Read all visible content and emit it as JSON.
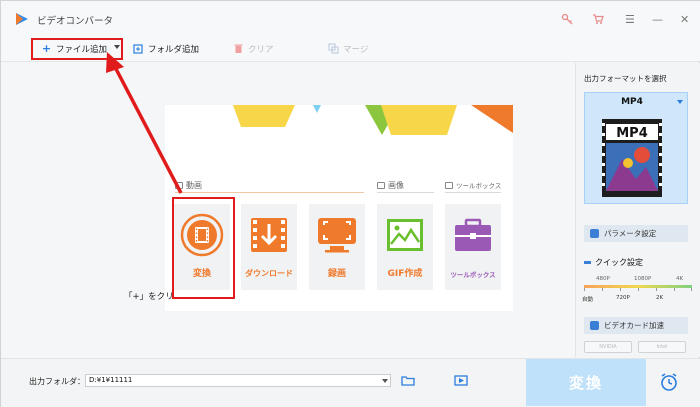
{
  "app": {
    "title": "ビデオコンバータ"
  },
  "window_controls": {
    "minimize": "—",
    "close": "✕",
    "menu": "☰"
  },
  "toolbar": {
    "add_file_label": "ファイル追加",
    "add_folder_label": "フォルダ追加",
    "clear_label": "クリア",
    "merge_label": "マージ"
  },
  "main": {
    "hint_text": "「+」をクリ",
    "sections": {
      "video": "動画",
      "image": "画像",
      "toolbox": "ツールボックス"
    },
    "cards": [
      {
        "label": "変換",
        "color": "#f07a2c"
      },
      {
        "label": "ダウンロード",
        "color": "#f07a2c"
      },
      {
        "label": "録画",
        "color": "#f07a2c"
      },
      {
        "label": "GIF作成",
        "color": "#f07a2c"
      },
      {
        "label": "ツールボックス",
        "color": "#9b59b6"
      }
    ]
  },
  "side": {
    "title": "出力フォーマットを選択",
    "format": "MP4",
    "format_badge": "MP4",
    "param_button": "パラメータ設定",
    "quick_title": "クイック設定",
    "scale_top": [
      "480P",
      "1080P",
      "4K"
    ],
    "scale_bottom": [
      "自動",
      "720P",
      "2K"
    ],
    "gpu_button": "ビデオカード加速",
    "hw": [
      "NVIDIA",
      "Intel"
    ]
  },
  "bottom": {
    "output_label": "出力フォルダ：",
    "output_path": "D:¥1¥11111",
    "convert_label": "変換"
  },
  "colors": {
    "accent_blue": "#3a7fd5",
    "annotation_red": "#e11b1b",
    "convert_bg": "#bfe1f9"
  }
}
